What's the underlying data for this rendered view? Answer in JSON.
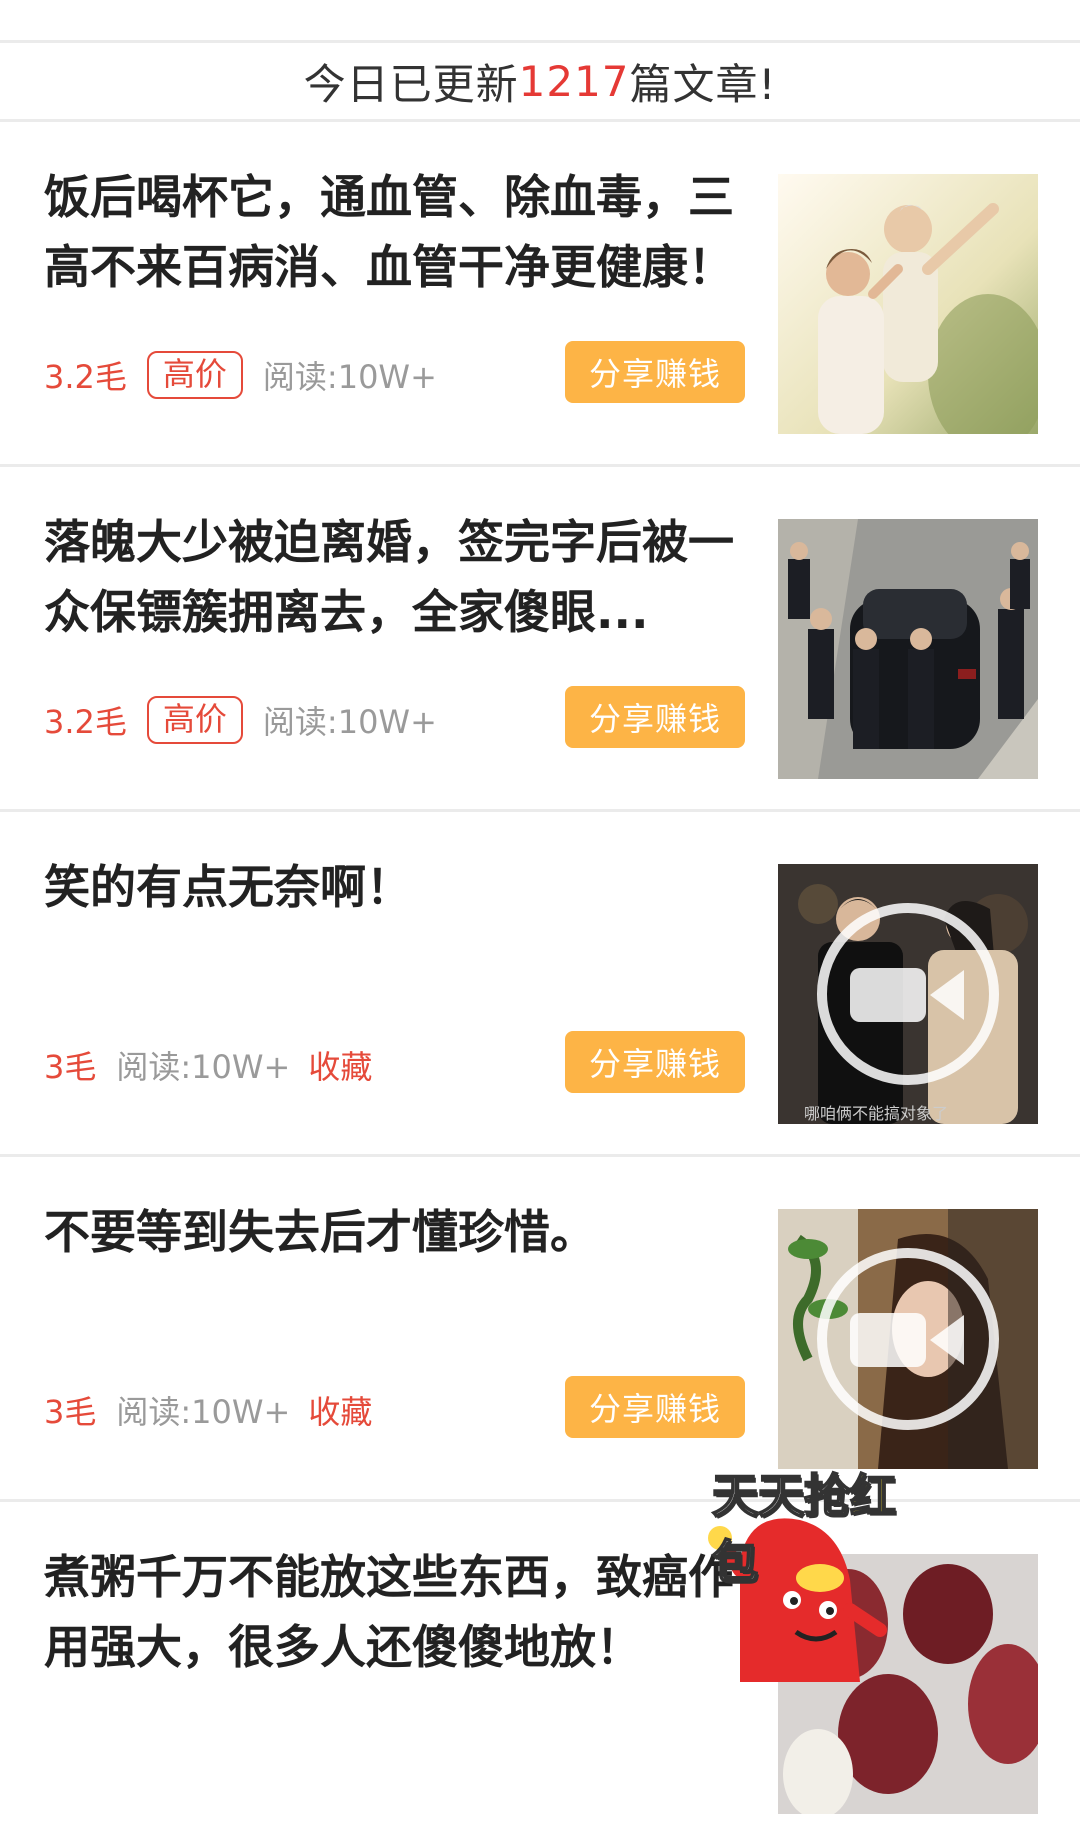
{
  "banner": {
    "prefix": "今日已更新",
    "count": "1217",
    "suffix": "篇文章!"
  },
  "articles": [
    {
      "title": "饭后喝杯它，通血管、除血毒，三高不来百病消、血管干净更健康！",
      "price": "3.2毛",
      "tag": "高价",
      "reads": "阅读:10W+",
      "share_label": "分享赚钱",
      "thumbnail": "elderly-couple-image",
      "has_video": false
    },
    {
      "title": "落魄大少被迫离婚，签完字后被一众保镖簇拥离去，全家傻眼...",
      "price": "3.2毛",
      "tag": "高价",
      "reads": "阅读:10W+",
      "share_label": "分享赚钱",
      "thumbnail": "black-car-bodyguards-image",
      "has_video": false
    },
    {
      "title": "笑的有点无奈啊！",
      "price": "3毛",
      "reads": "阅读:10W+",
      "fav": "收藏",
      "share_label": "分享赚钱",
      "thumbnail": "couple-video-frame",
      "caption": "哪咱俩不能搞对象了",
      "has_video": true
    },
    {
      "title": "不要等到失去后才懂珍惜。",
      "price": "3毛",
      "reads": "阅读:10W+",
      "fav": "收藏",
      "share_label": "分享赚钱",
      "thumbnail": "woman-window-video-frame",
      "has_video": true
    },
    {
      "title": "煮粥千万不能放这些东西，致癌作用强大，很多人还傻傻地放！",
      "thumbnail": "red-dates-image",
      "has_video": false
    }
  ],
  "float_ad": {
    "label_part1": "天天抢",
    "label_highlight": "红",
    "label_part2": "包",
    "icon": "red-envelope-mascot-icon"
  },
  "colors": {
    "accent_red": "#e53935",
    "share_orange": "#fdb446",
    "divider": "#ebebeb"
  }
}
